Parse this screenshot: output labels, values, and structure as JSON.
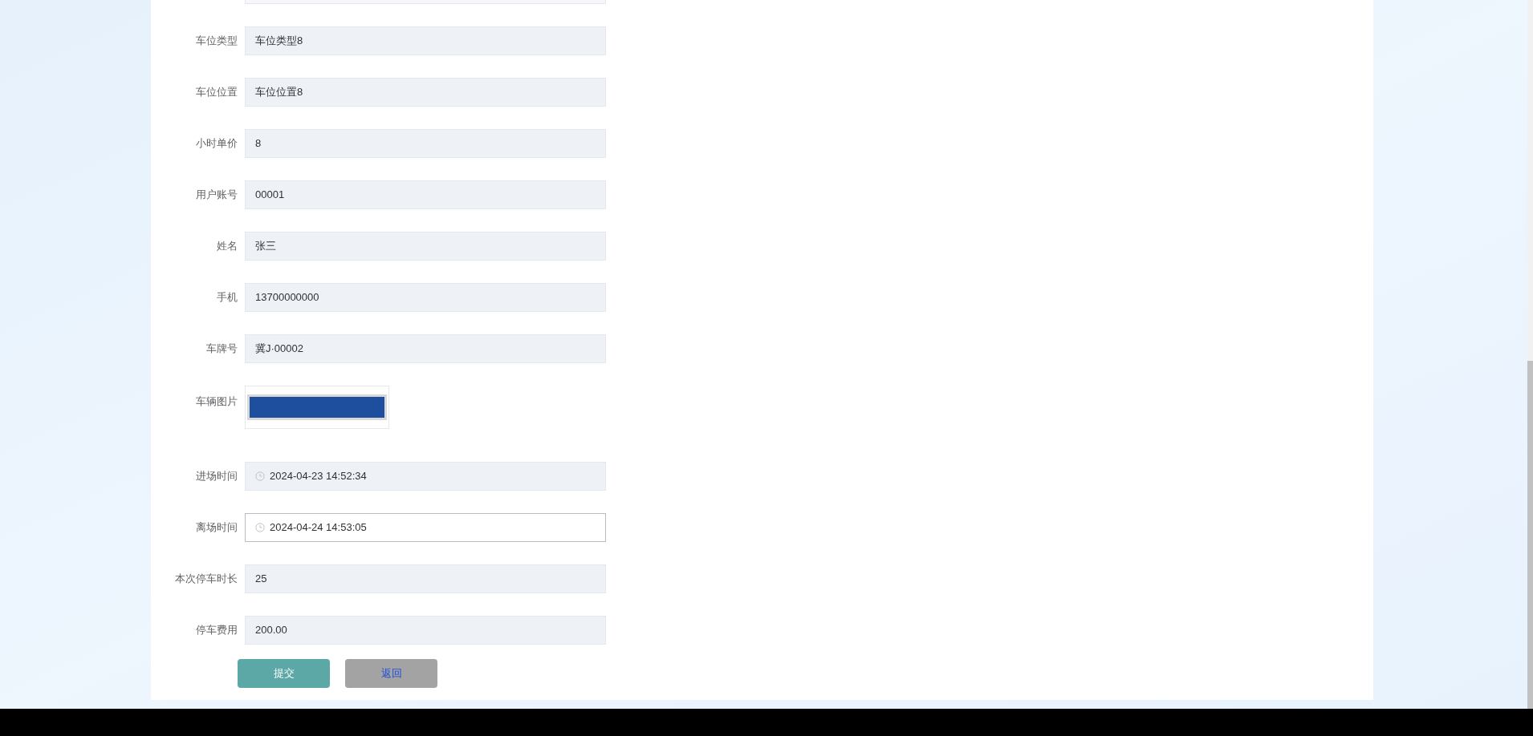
{
  "form": {
    "fields": [
      {
        "label": "车位类型",
        "value": "车位类型8",
        "kind": "text",
        "disabled": true
      },
      {
        "label": "车位位置",
        "value": "车位位置8",
        "kind": "text",
        "disabled": true
      },
      {
        "label": "小时单价",
        "value": "8",
        "kind": "text",
        "disabled": true
      },
      {
        "label": "用户账号",
        "value": "00001",
        "kind": "text",
        "disabled": true
      },
      {
        "label": "姓名",
        "value": "张三",
        "kind": "text",
        "disabled": true
      },
      {
        "label": "手机",
        "value": "13700000000",
        "kind": "text",
        "disabled": true
      },
      {
        "label": "车牌号",
        "value": "冀J·00002",
        "kind": "text",
        "disabled": true
      },
      {
        "label": "车辆图片",
        "kind": "image"
      },
      {
        "label": "进场时间",
        "value": "2024-04-23 14:52:34",
        "kind": "datetime",
        "disabled": true
      },
      {
        "label": "离场时间",
        "value": "2024-04-24 14:53:05",
        "kind": "datetime",
        "disabled": false
      },
      {
        "label": "本次停车时长",
        "value": "25",
        "kind": "text",
        "disabled": true
      },
      {
        "label": "停车费用",
        "value": "200.00",
        "kind": "text",
        "disabled": true
      }
    ]
  },
  "buttons": [
    {
      "label": "提交",
      "kind": "primary"
    },
    {
      "label": "返回",
      "kind": "secondary"
    }
  ]
}
